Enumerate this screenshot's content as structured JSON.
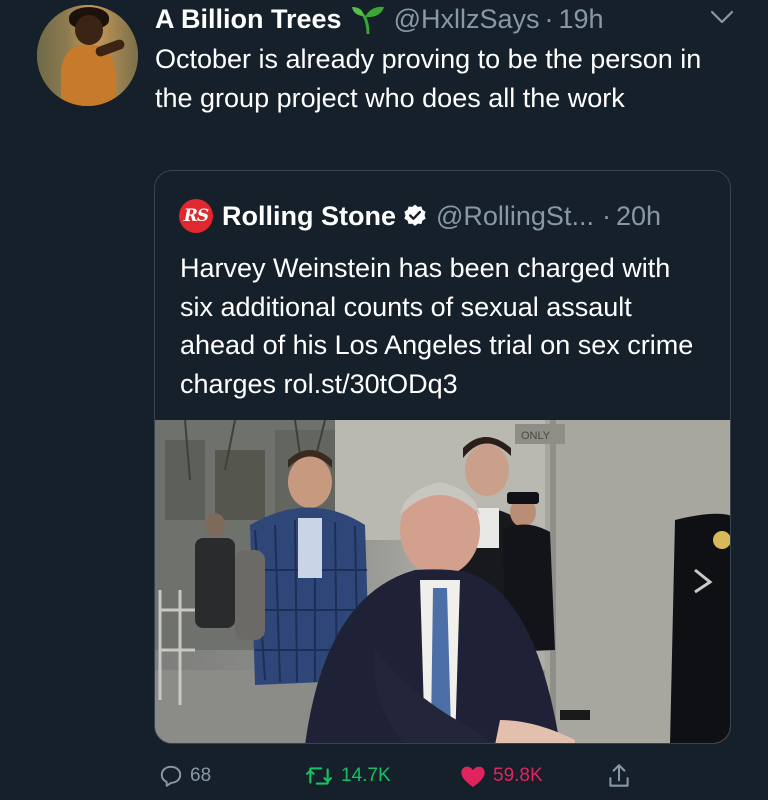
{
  "tweet": {
    "author": {
      "display_name": "A Billion Trees",
      "emoji": "seedling-icon",
      "handle": "@HxllzSays",
      "time": "19h"
    },
    "text": "October is already proving to be the person in the group project who does all the work"
  },
  "quoted_tweet": {
    "logo_text": "RS",
    "display_name": "Rolling Stone",
    "verified": true,
    "handle": "@RollingSt...",
    "time": "20h",
    "text": "Harvey Weinstein has been charged with six additional counts of sexual assault ahead of his Los Angeles trial on sex crime charges rol.st/30tODq3",
    "media": {
      "sign_text": "ONLY"
    }
  },
  "actions": {
    "reply_count": "68",
    "retweet_count": "14.7K",
    "like_count": "59.8K"
  },
  "colors": {
    "background": "#15202b",
    "secondary_text": "#8899a6",
    "retweet_active": "#17bf63",
    "like_active": "#e0245e",
    "brand_rs": "#e0282e",
    "verified": "#ffffff"
  },
  "separator": "·"
}
